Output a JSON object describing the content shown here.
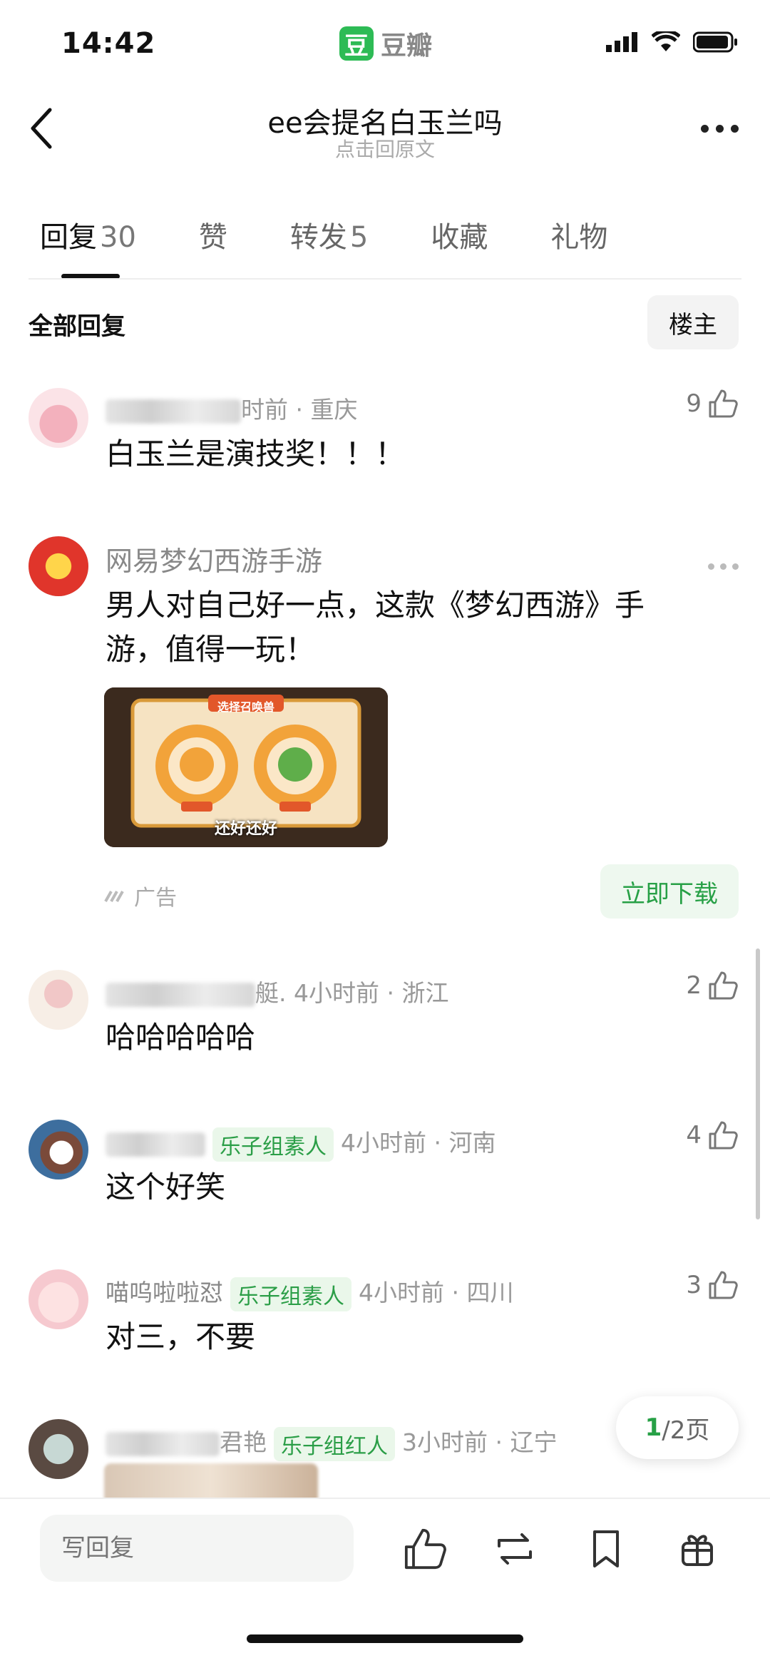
{
  "status": {
    "time": "14:42",
    "brand_logo": "豆",
    "brand_name": "豆瓣"
  },
  "nav": {
    "title": "ee会提名白玉兰吗",
    "subtitle": "点击回原文"
  },
  "tabs": [
    {
      "label": "回复",
      "count": "30"
    },
    {
      "label": "赞",
      "count": ""
    },
    {
      "label": "转发",
      "count": "5"
    },
    {
      "label": "收藏",
      "count": ""
    },
    {
      "label": "礼物",
      "count": ""
    }
  ],
  "section": {
    "title": "全部回复",
    "owner_button": "楼主"
  },
  "comments": [
    {
      "username": "",
      "badge": "",
      "time": "时前",
      "location": "重庆",
      "text": "白玉兰是演技奖！！！",
      "likes": "9"
    },
    {
      "username": "艇. ",
      "badge": "",
      "time": "4小时前",
      "location": "浙江",
      "text": "哈哈哈哈哈",
      "likes": "2"
    },
    {
      "username": "",
      "badge": "乐子组素人",
      "time": "4小时前",
      "location": "河南",
      "text": "这个好笑",
      "likes": "4"
    },
    {
      "username": "喵呜啦啦怼",
      "badge": "乐子组素人",
      "time": "4小时前",
      "location": "四川",
      "text": "对三，不要",
      "likes": "3"
    },
    {
      "username": "君艳",
      "badge": "乐子组红人",
      "time": "3小时前",
      "location": "辽宁",
      "text": "",
      "likes": ""
    }
  ],
  "ad": {
    "name": "网易梦幻西游手游",
    "text": "男人对自己好一点，这款《梦幻西游》手游，值得一玩！",
    "image_caption": "还好还好",
    "image_header": "选择召唤兽",
    "label": "广告",
    "button": "立即下载"
  },
  "pager": {
    "current": "1",
    "total": "/2页"
  },
  "bottom": {
    "reply_placeholder": "写回复"
  },
  "colors": {
    "accent": "#27a046",
    "brand": "#2dbb55",
    "badge_bg": "#eaf7ea"
  }
}
